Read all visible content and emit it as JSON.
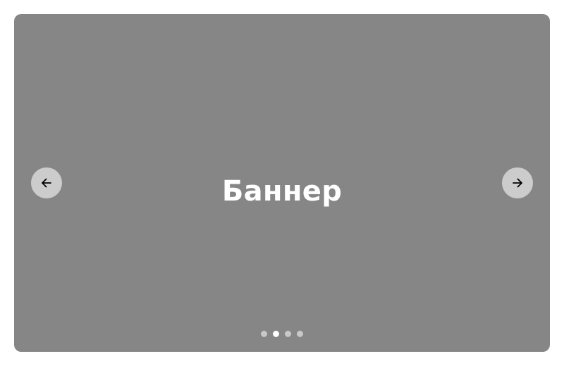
{
  "banner": {
    "title": "Баннер",
    "background_color": "#868686",
    "title_color": "#ffffff"
  },
  "navigation": {
    "prev_icon": "arrow-left-icon",
    "next_icon": "arrow-right-icon",
    "button_color": "#cccccc"
  },
  "pagination": {
    "total": 4,
    "active_index": 1,
    "active_color": "#ffffff",
    "inactive_color": "#c8c8c8"
  }
}
